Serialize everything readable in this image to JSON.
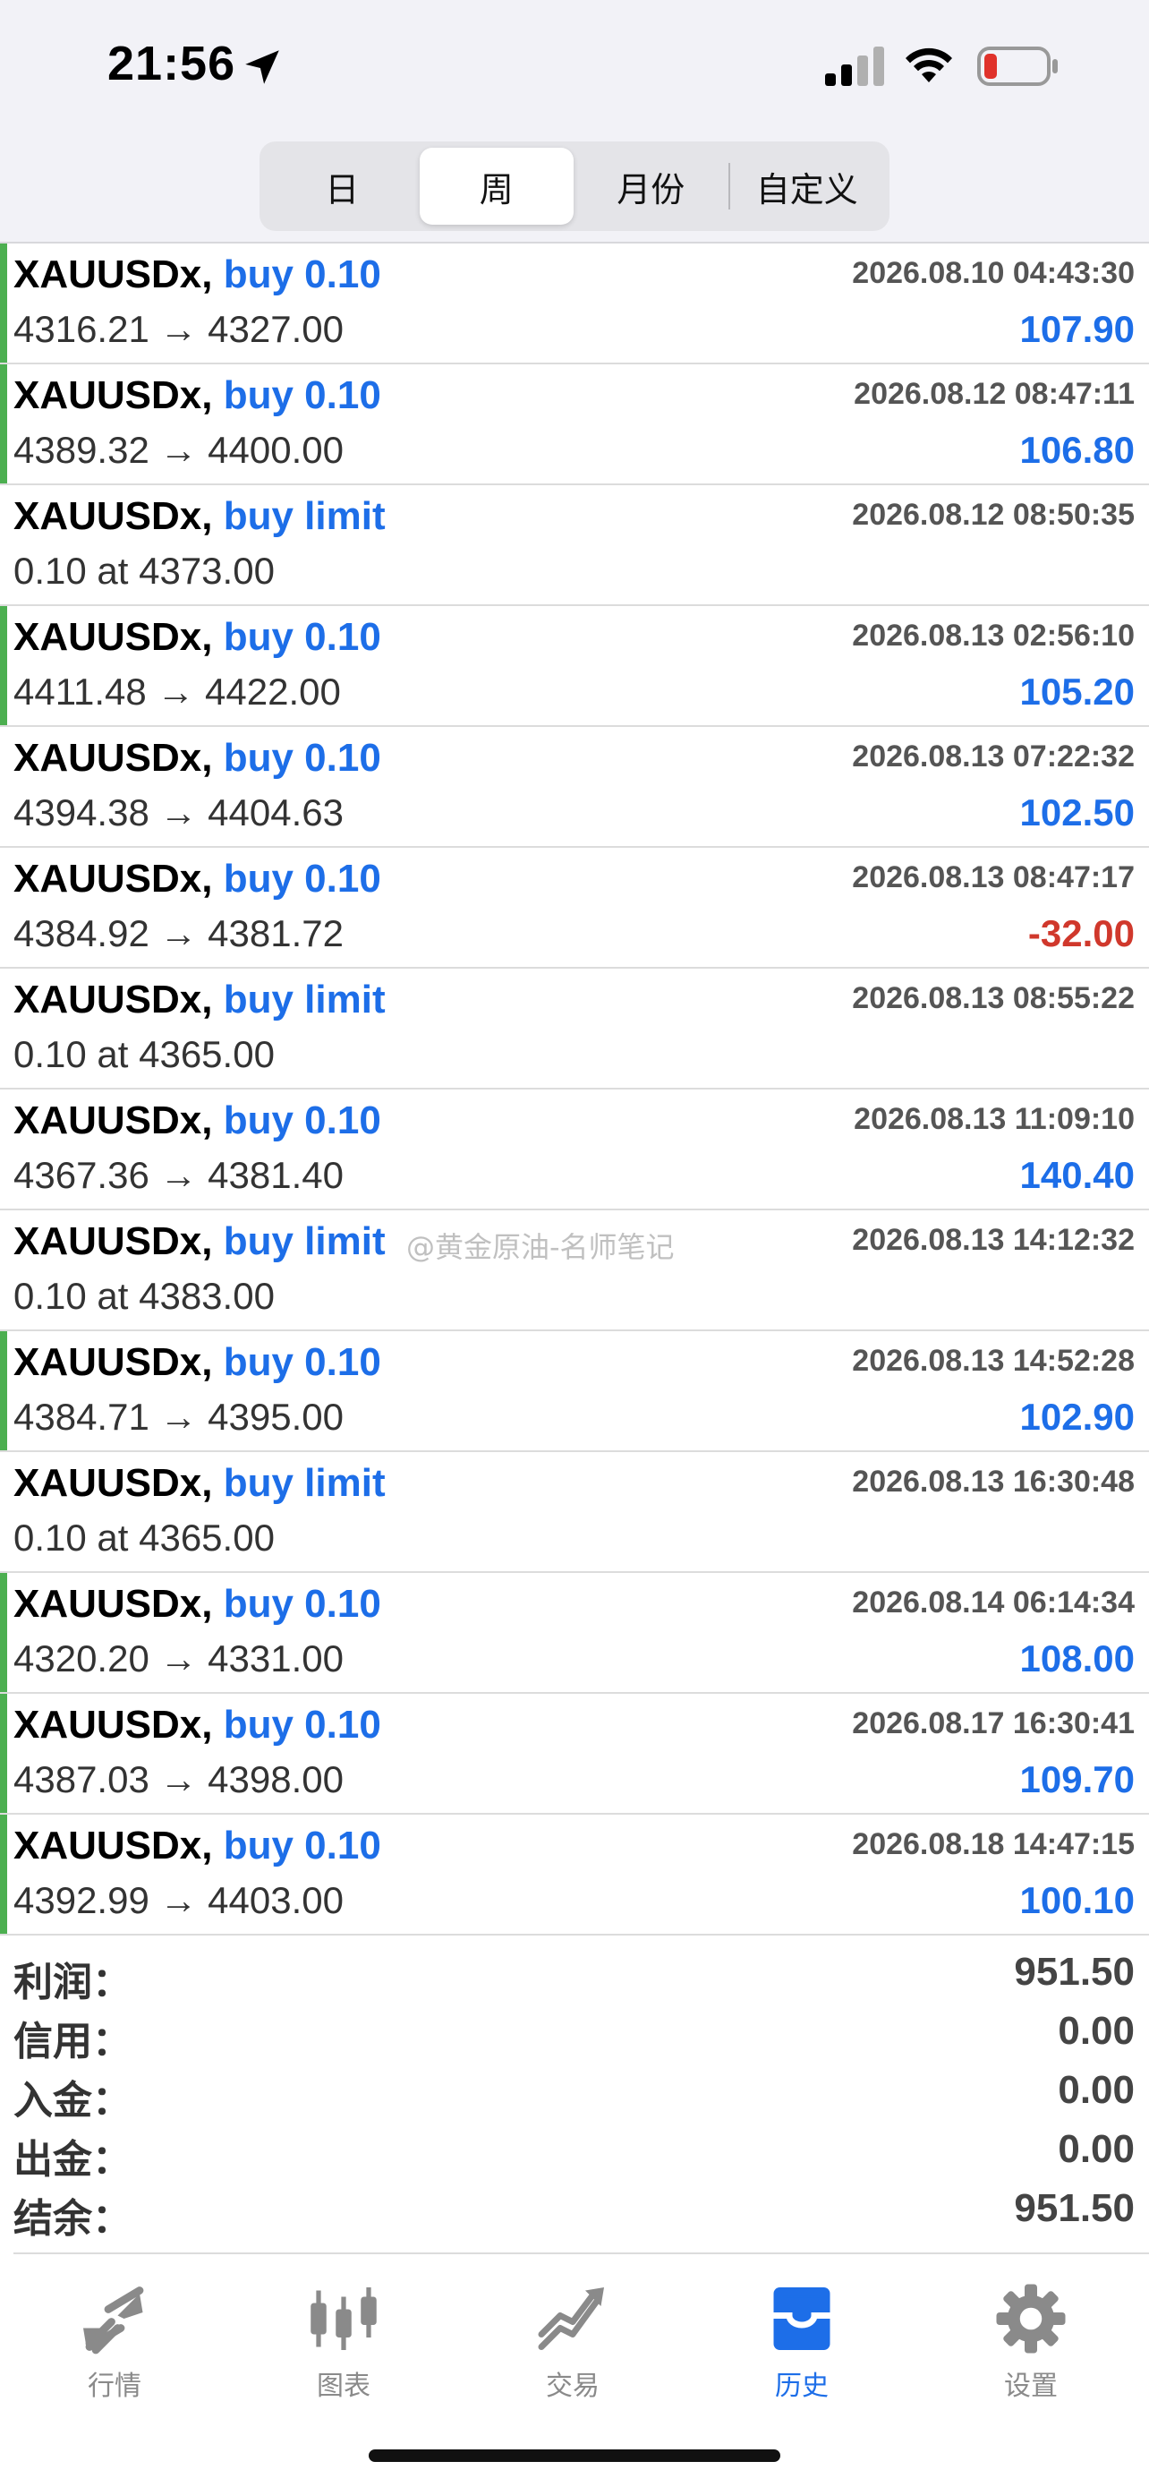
{
  "status_bar": {
    "time": "21:56"
  },
  "period_tabs": [
    "日",
    "周",
    "月份",
    "自定义"
  ],
  "orders": [
    {
      "symbol": "XAUUSDx,",
      "type": "buy 0.10",
      "date": "2026.08.10 04:43:30",
      "prices": "4316.21 → 4327.00",
      "profit": "107.90",
      "negative": false,
      "bar": true
    },
    {
      "symbol": "XAUUSDx,",
      "type": "buy 0.10",
      "date": "2026.08.12 08:47:11",
      "prices": "4389.32 → 4400.00",
      "profit": "106.80",
      "negative": false,
      "bar": true
    },
    {
      "symbol": "XAUUSDx,",
      "type": "buy limit",
      "date": "2026.08.12 08:50:35",
      "prices": "0.10 at 4373.00",
      "profit": "",
      "negative": false,
      "bar": false
    },
    {
      "symbol": "XAUUSDx,",
      "type": "buy 0.10",
      "date": "2026.08.13 02:56:10",
      "prices": "4411.48 → 4422.00",
      "profit": "105.20",
      "negative": false,
      "bar": true
    },
    {
      "symbol": "XAUUSDx,",
      "type": "buy 0.10",
      "date": "2026.08.13 07:22:32",
      "prices": "4394.38 → 4404.63",
      "profit": "102.50",
      "negative": false,
      "bar": false
    },
    {
      "symbol": "XAUUSDx,",
      "type": "buy 0.10",
      "date": "2026.08.13 08:47:17",
      "prices": "4384.92 → 4381.72",
      "profit": "-32.00",
      "negative": true,
      "bar": false
    },
    {
      "symbol": "XAUUSDx,",
      "type": "buy limit",
      "date": "2026.08.13 08:55:22",
      "prices": "0.10 at 4365.00",
      "profit": "",
      "negative": false,
      "bar": false
    },
    {
      "symbol": "XAUUSDx,",
      "type": "buy 0.10",
      "date": "2026.08.13 11:09:10",
      "prices": "4367.36 → 4381.40",
      "profit": "140.40",
      "negative": false,
      "bar": false
    },
    {
      "symbol": "XAUUSDx,",
      "type": "buy limit",
      "date": "2026.08.13 14:12:32",
      "prices": "0.10 at 4383.00",
      "profit": "",
      "negative": false,
      "bar": false
    },
    {
      "symbol": "XAUUSDx,",
      "type": "buy 0.10",
      "date": "2026.08.13 14:52:28",
      "prices": "4384.71 → 4395.00",
      "profit": "102.90",
      "negative": false,
      "bar": true
    },
    {
      "symbol": "XAUUSDx,",
      "type": "buy limit",
      "date": "2026.08.13 16:30:48",
      "prices": "0.10 at 4365.00",
      "profit": "",
      "negative": false,
      "bar": false
    },
    {
      "symbol": "XAUUSDx,",
      "type": "buy 0.10",
      "date": "2026.08.14 06:14:34",
      "prices": "4320.20 → 4331.00",
      "profit": "108.00",
      "negative": false,
      "bar": true
    },
    {
      "symbol": "XAUUSDx,",
      "type": "buy 0.10",
      "date": "2026.08.17 16:30:41",
      "prices": "4387.03 → 4398.00",
      "profit": "109.70",
      "negative": false,
      "bar": true
    },
    {
      "symbol": "XAUUSDx,",
      "type": "buy 0.10",
      "date": "2026.08.18 14:47:15",
      "prices": "4392.99 → 4403.00",
      "profit": "100.10",
      "negative": false,
      "bar": true
    }
  ],
  "watermark": "@黄金原油-名师笔记",
  "summary": [
    {
      "label": "利润：",
      "value": "951.50"
    },
    {
      "label": "信用：",
      "value": "0.00"
    },
    {
      "label": "入金：",
      "value": "0.00"
    },
    {
      "label": "出金：",
      "value": "0.00"
    },
    {
      "label": "结余：",
      "value": "951.50"
    }
  ],
  "tabbar": [
    {
      "label": "行情",
      "icon": "quotes-icon"
    },
    {
      "label": "图表",
      "icon": "chart-icon"
    },
    {
      "label": "交易",
      "icon": "trade-icon"
    },
    {
      "label": "历史",
      "icon": "history-icon"
    },
    {
      "label": "设置",
      "icon": "settings-icon"
    }
  ],
  "colors": {
    "accent": "#1d6ee8",
    "negative": "#d0382c",
    "position_bar": "#4caf50"
  }
}
